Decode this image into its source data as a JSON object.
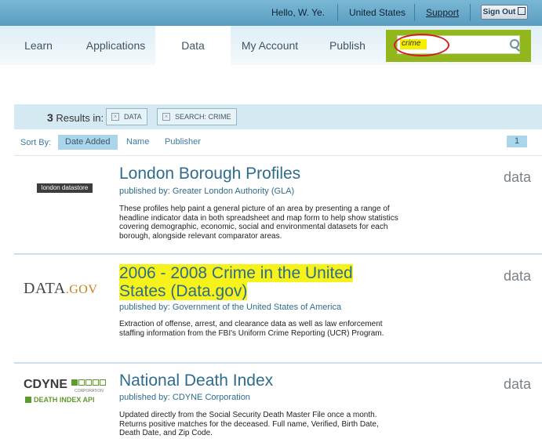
{
  "header": {
    "greeting": "Hello, W. Ye.",
    "country": "United States",
    "support": "Support",
    "signout": "Sign Out"
  },
  "nav": {
    "items": [
      "Learn",
      "Applications",
      "Data",
      "My Account",
      "Publish"
    ],
    "active": "Data"
  },
  "search": {
    "value": "crime",
    "placeholder": ""
  },
  "results": {
    "count": "3",
    "label": "Results in:",
    "filters": [
      "DATA",
      "SEARCH: CRIME"
    ]
  },
  "sort": {
    "label": "Sort By:",
    "options": [
      "Date Added",
      "Name",
      "Publisher"
    ],
    "active": "Date Added",
    "page": "1"
  },
  "items": [
    {
      "title": "London Borough Profiles",
      "published_by_label": "published by:",
      "publisher": "Greater London Authority (GLA)",
      "description": "These profiles help paint a general picture of an area by presenting a range of headline indicator data in both spreadsheet and map form to help show statistics covering demographic, economic, social and environmental datasets for each borough, alongside relevant comparator areas.",
      "kind": "data",
      "logo_text": "london datastore"
    },
    {
      "title_line1": "2006 - 2008 Crime in the United",
      "title_line2": "States (Data.gov)",
      "published_by_label": "published by:",
      "publisher": "Government of the United States of America",
      "description": "Extraction of offense, arrest, and clearance data as well as law enforcement staffing information from the FBI's Uniform Crime Reporting (UCR) Program.",
      "kind": "data",
      "logo_text": "DATA",
      "logo_suffix": ".GOV"
    },
    {
      "title": "National Death Index",
      "published_by_label": "published by:",
      "publisher": "CDYNE Corporation",
      "description": "Updated directly from the Social Security Death Master File once a month. Returns positive matches for the deceased. Full name, Verified, Birth Date, Death Date, and Zip Code.",
      "kind": "data",
      "logo_text": "CDYNE",
      "logo_corp": "CORPORATION",
      "logo_sub": "DEATH INDEX API"
    }
  ],
  "colors": {
    "topbar": "#6aabcb",
    "search_bg": "#92b71c",
    "link": "#2e6c8c",
    "highlight": "#f7f31a"
  }
}
